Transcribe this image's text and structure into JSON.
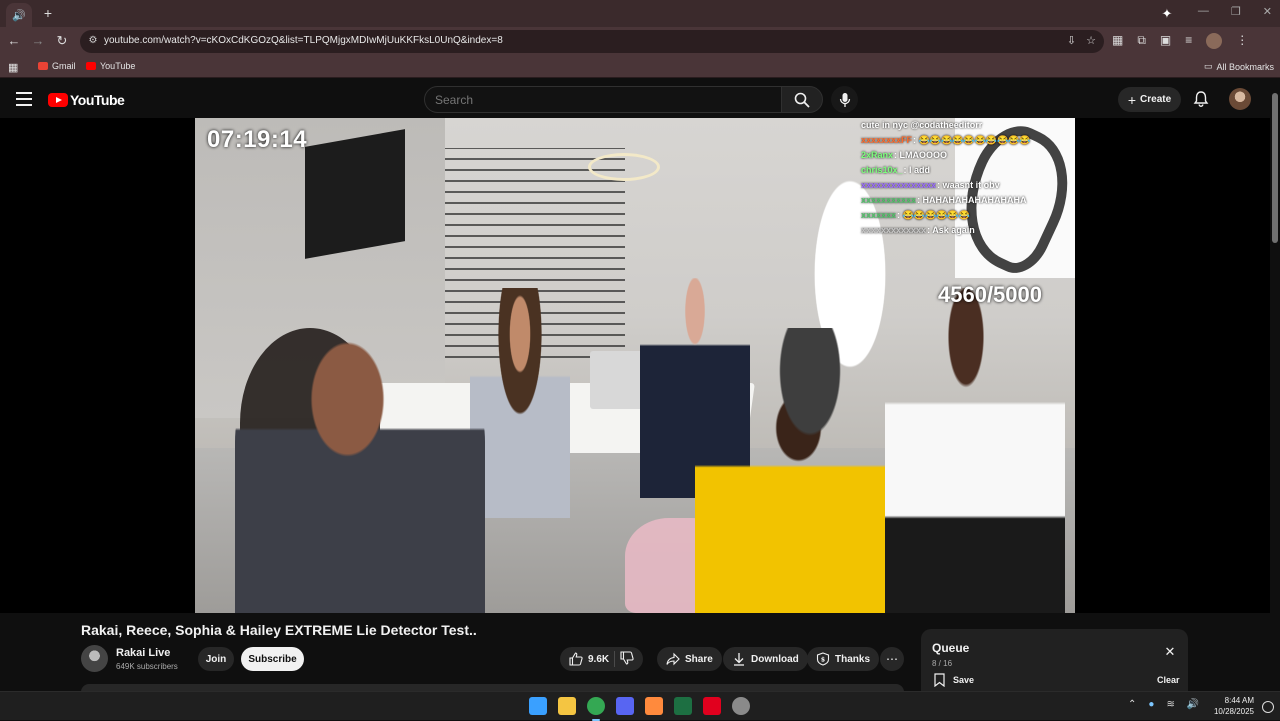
{
  "browser": {
    "url": "youtube.com/watch?v=cKOxCdKGOzQ&list=TLPQMjgxMDIwMjUuKKFksL0UnQ&index=8",
    "bookmarks": [
      {
        "label": "Gmail",
        "color": "#ea4335"
      },
      {
        "label": "YouTube",
        "color": "#ff0000"
      }
    ],
    "all_bookmarks": "All Bookmarks"
  },
  "youtube": {
    "logo_text": "YouTube",
    "search_placeholder": "Search",
    "create_label": "Create"
  },
  "video": {
    "timer": "07:19:14",
    "goal": "4560/5000",
    "chat": [
      {
        "user": "",
        "msg": "cute in nyc @codatheeditorr",
        "color": "#ffffff"
      },
      {
        "user": "xxxxxxxxFF",
        "msg": ": 😂😂😂😂😂😂😂😂😂😂",
        "color": "#ff6b2b"
      },
      {
        "user": "2xRanx",
        "msg": ": LMAOOOO",
        "color": "#7dff7d"
      },
      {
        "user": "chris10x_",
        "msg": ": I add",
        "color": "#7dff7d"
      },
      {
        "user": "xxxxxxxxxxxxxxx",
        "msg": ": waasnt it obv",
        "color": "#9a6bff"
      },
      {
        "user": "xxxxxxxxxxx",
        "msg": ": HAHAHAHAHAHAHAHA",
        "color": "#52c46b"
      },
      {
        "user": "xxxxxxx",
        "msg": ": 😂😂😂😂😂😂",
        "color": "#52c46b"
      },
      {
        "user": "xxxxxxxxxxxxx",
        "msg": ": Ask again",
        "color": "#c8c8c8"
      }
    ]
  },
  "meta": {
    "title": "Rakai, Reece, Sophia & Hailey EXTREME Lie Detector Test..",
    "channel": "Rakai Live",
    "subscribers": "649K subscribers",
    "join": "Join",
    "subscribe": "Subscribe",
    "likes": "9.6K",
    "share": "Share",
    "download": "Download",
    "thanks": "Thanks"
  },
  "queue": {
    "title": "Queue",
    "count": "8 / 16",
    "save": "Save",
    "clear": "Clear"
  },
  "taskbar": {
    "time": "8:44 AM",
    "date": "10/28/2025",
    "apps": [
      {
        "name": "windows-start-icon",
        "color": "#3aa0ff"
      },
      {
        "name": "file-explorer-icon",
        "color": "#f4c542"
      },
      {
        "name": "chrome-icon",
        "color": "#34a853"
      },
      {
        "name": "discord-icon",
        "color": "#5865f2"
      },
      {
        "name": "ableton-icon",
        "color": "#ff8a3d"
      },
      {
        "name": "excel-icon",
        "color": "#1d6f42"
      },
      {
        "name": "youtube-music-icon",
        "color": "#e1001e"
      },
      {
        "name": "app-icon",
        "color": "#8a8a8a"
      }
    ]
  }
}
